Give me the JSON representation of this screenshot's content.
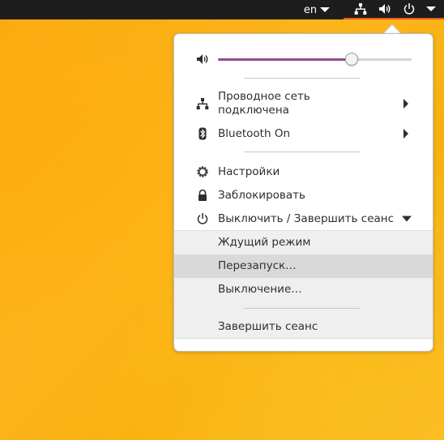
{
  "topbar": {
    "language": "en",
    "indicators": [
      "network-icon",
      "volume-icon",
      "power-icon"
    ]
  },
  "menu": {
    "volume": {
      "level_percent": 69
    },
    "network": {
      "label_line1": "Проводное сеть",
      "label_line2": "подключена"
    },
    "bluetooth": {
      "label": "Bluetooth On"
    },
    "settings": {
      "label": "Настройки"
    },
    "lock": {
      "label": "Заблокировать"
    },
    "power": {
      "label": "Выключить / Завершить сеанс"
    },
    "submenu": {
      "suspend": "Ждущий режим",
      "restart": "Перезапуск…",
      "shutdown": "Выключение…",
      "logout": "Завершить сеанс"
    }
  },
  "colors": {
    "desktop": "#f9ab12",
    "topbar": "#1d1d1d",
    "slider_fill": "#924d8b",
    "accent_underline": "#e95420"
  }
}
